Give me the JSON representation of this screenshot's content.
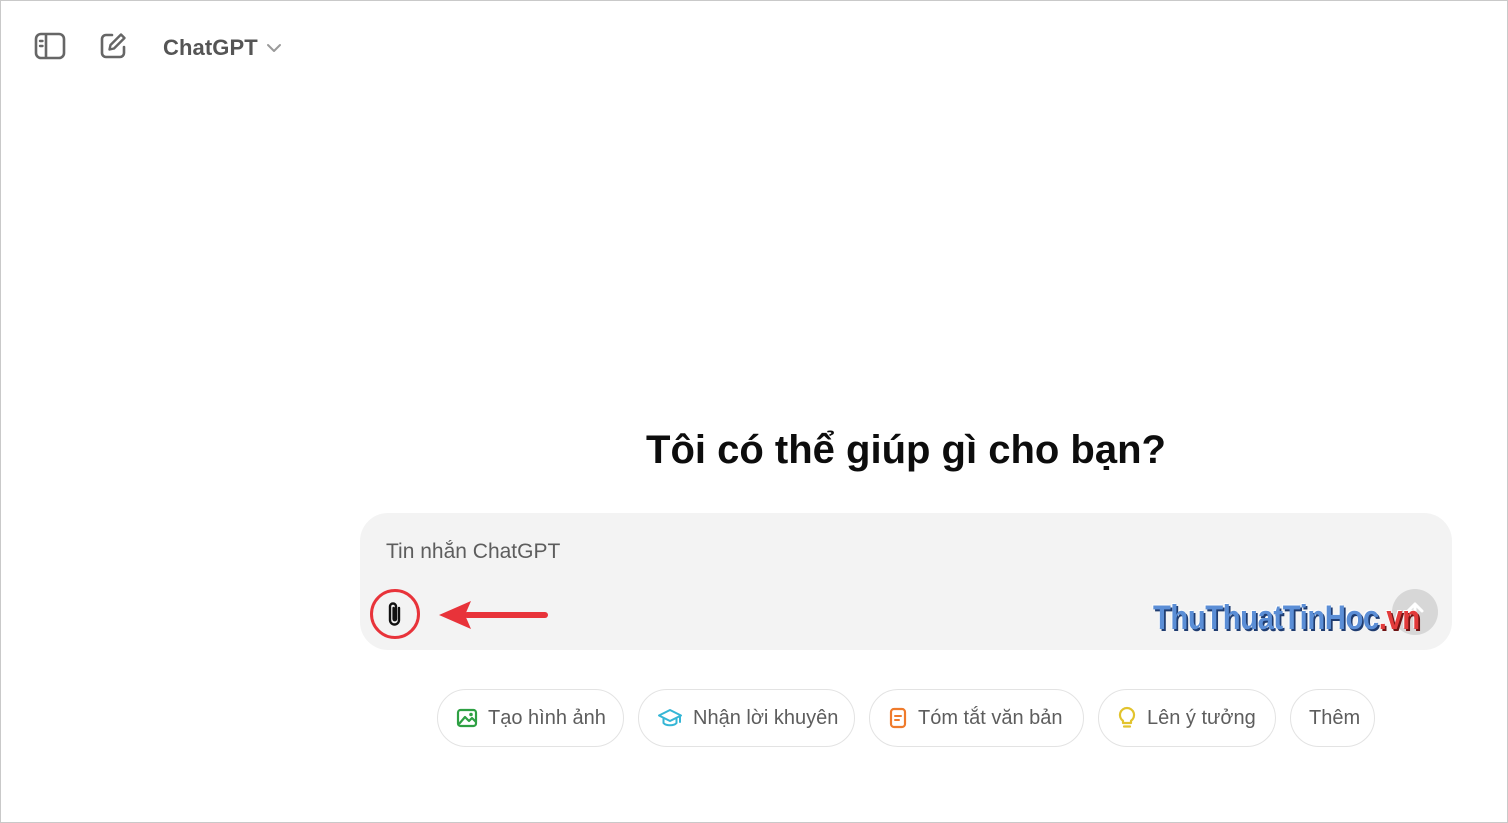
{
  "header": {
    "model_name": "ChatGPT",
    "icons": [
      "sidebar-toggle-icon",
      "new-chat-icon",
      "chevron-down-icon"
    ]
  },
  "main": {
    "headline": "Tôi có thể giúp gì cho bạn?"
  },
  "composer": {
    "placeholder": "Tin nhắn ChatGPT",
    "value": "",
    "attach_icon": "paperclip-icon",
    "send_icon": "arrow-up-icon"
  },
  "suggestions": [
    {
      "label": "Tạo hình ảnh",
      "icon": "image-icon",
      "color": "#2ea043"
    },
    {
      "label": "Nhận lời khuyên",
      "icon": "graduation-cap-icon",
      "color": "#35b6d6"
    },
    {
      "label": "Tóm tắt văn bản",
      "icon": "document-icon",
      "color": "#ef7b2c"
    },
    {
      "label": "Lên ý tưởng",
      "icon": "lightbulb-icon",
      "color": "#e2c32d"
    },
    {
      "label": "Thêm"
    }
  ],
  "watermark": {
    "main": "ThuThuatTinHoc",
    "tail": ".vn"
  },
  "colors": {
    "annotation_red": "#e8333a",
    "composer_bg": "#f3f3f3",
    "send_button_bg": "#d7d7d7"
  }
}
